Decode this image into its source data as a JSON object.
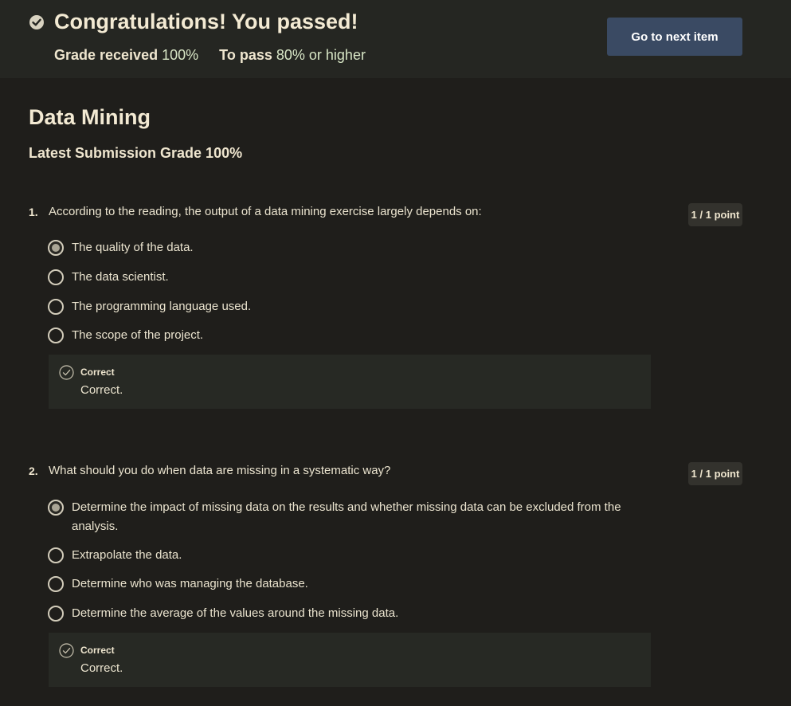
{
  "banner": {
    "title": "Congratulations! You passed!",
    "grade_label": "Grade received",
    "grade_value": "100%",
    "pass_label": "To pass",
    "pass_value": "80% or higher",
    "next_button": "Go to next item"
  },
  "quiz": {
    "title": "Data Mining",
    "latest_grade": "Latest Submission Grade 100%"
  },
  "questions": [
    {
      "number": "1.",
      "text": "According to the reading, the output of a data mining exercise largely depends on:",
      "points": "1 / 1 point",
      "options": [
        {
          "label": "The quality of the data.",
          "selected": true
        },
        {
          "label": "The data scientist.",
          "selected": false
        },
        {
          "label": "The programming language used.",
          "selected": false
        },
        {
          "label": "The scope of the project.",
          "selected": false
        }
      ],
      "feedback": {
        "heading": "Correct",
        "body": "Correct."
      }
    },
    {
      "number": "2.",
      "text": "What should you do when data are missing in a systematic way?",
      "points": "1 / 1 point",
      "options": [
        {
          "label": "Determine the impact of missing data on the results and whether missing data can be excluded from the analysis.",
          "selected": true
        },
        {
          "label": "Extrapolate the data.",
          "selected": false
        },
        {
          "label": "Determine who was managing the database.",
          "selected": false
        },
        {
          "label": "Determine the average of the values around the missing data.",
          "selected": false
        }
      ],
      "feedback": {
        "heading": "Correct",
        "body": "Correct."
      }
    }
  ],
  "colors": {
    "background": "#1f1e1b",
    "banner": "#252622",
    "button": "#3a4a63",
    "feedback_box": "#272924"
  }
}
